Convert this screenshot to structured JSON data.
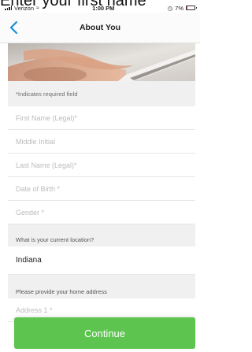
{
  "overlay_caption": "Enter your first name",
  "status_bar": {
    "carrier": "Verizon",
    "time": "1:00 PM",
    "battery_percent": "7%",
    "battery_level": 0.07,
    "battery_fill_color": "#e53935"
  },
  "nav": {
    "back_icon": "chevron-left-icon",
    "title": "About You",
    "accent_color": "#1a8fd8"
  },
  "form": {
    "required_note": "*Indicates required field",
    "fields": {
      "first_name_placeholder": "First Name (Legal)*",
      "middle_initial_placeholder": "Middle Initial",
      "last_name_placeholder": "Last Name (Legal)*",
      "dob_placeholder": "Date of Birth *",
      "gender_placeholder": "Gender *"
    },
    "location_question": "What is your current location?",
    "location_value": "Indiana",
    "address_prompt": "Please provide your home address",
    "address1_placeholder": "Address 1 *"
  },
  "continue_label": "Continue",
  "continue_color": "#5dc44f"
}
